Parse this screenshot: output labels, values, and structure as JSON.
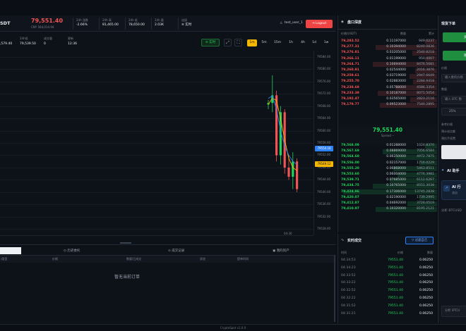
{
  "header": {
    "symbol_partial": "SDT",
    "price": "79,551.40",
    "price_sub": "CNY 564,014.94",
    "stats": [
      {
        "label": "24h 涨跌",
        "value": "-2.66%",
        "color": "#f25454"
      },
      {
        "label": "24h 高",
        "value": "81,465.00",
        "color": "#e6edf3"
      },
      {
        "label": "24h 低",
        "value": "78,650.00",
        "color": "#e6edf3"
      },
      {
        "label": "24h 量",
        "value": "2.03K",
        "color": "#e6edf3"
      },
      {
        "label": "连接",
        "value": "实时",
        "color": "#1fd35a"
      }
    ],
    "user": "test_user_1",
    "logout": "Logout"
  },
  "chart_info": {
    "cells": [
      {
        "label": "",
        "value": ",579.40"
      },
      {
        "label": "24h低",
        "value": "79,539.50"
      },
      {
        "label": "成交量",
        "value": "0"
      },
      {
        "label": "更新",
        "value": "12:36"
      }
    ],
    "live_label": "实时",
    "timeframes": [
      "1m",
      "5m",
      "15m",
      "1h",
      "4h",
      "1d",
      "1w"
    ],
    "active_tf": "1m",
    "time_tick": "04:30"
  },
  "chart_data": {
    "type": "candlestick",
    "yticks": [
      "79584.00",
      "79580.00",
      "79576.00",
      "79572.00",
      "79568.00",
      "79564.00",
      "79560.00",
      "79556.00",
      "79552.00",
      "79548.00",
      "79544.00",
      "79540.00",
      "79536.00",
      "79532.00",
      "79528.00"
    ],
    "ylim": [
      79526,
      79586
    ],
    "price_tags": [
      {
        "value": "79554.16",
        "color": "#2f81f7"
      },
      {
        "value": "79549.12",
        "color": "#f5b700"
      }
    ],
    "candles": [
      {
        "o": 79568.5,
        "h": 79570,
        "l": 79567,
        "c": 79569,
        "up": true
      },
      {
        "o": 79569,
        "h": 79578,
        "l": 79566,
        "c": 79571.5,
        "up": true
      },
      {
        "o": 79571.5,
        "h": 79573,
        "l": 79550,
        "c": 79552,
        "up": false
      },
      {
        "o": 79552,
        "h": 79568,
        "l": 79549,
        "c": 79566,
        "up": true
      },
      {
        "o": 79566,
        "h": 79567,
        "l": 79546,
        "c": 79548,
        "up": false
      },
      {
        "o": 79548,
        "h": 79552,
        "l": 79544,
        "c": 79545,
        "up": false
      },
      {
        "o": 79545,
        "h": 79553,
        "l": 79541,
        "c": 79550,
        "up": true
      },
      {
        "o": 79550,
        "h": 79551,
        "l": 79540,
        "c": 79541,
        "up": false
      }
    ],
    "ma_lines": [
      {
        "color": "#f5b700",
        "values": [
          79568.5,
          79570.6,
          79569.8,
          79564,
          79557,
          79551,
          79548,
          79547
        ]
      },
      {
        "color": "#2f81f7",
        "values": [
          79570.5,
          79571.3,
          79567,
          79560,
          79555,
          79552,
          79550,
          79549
        ]
      }
    ]
  },
  "orders": {
    "tabs": [
      "历史委托",
      "成交记录",
      "我的资产"
    ],
    "columns": [
      "/类型",
      "价格",
      "数量/已成交",
      "状态",
      "提单时间"
    ],
    "empty": "暂无当前订单"
  },
  "orderbook": {
    "title": "盘口深度",
    "columns": [
      "价格(USDT)",
      "数量",
      "累计"
    ],
    "asks": [
      [
        "79,283.52",
        "0.11197000",
        "949.0237",
        0.12
      ],
      [
        "79,277.31",
        "0.10394000",
        "8240.0836",
        0.62
      ],
      [
        "79,276.81",
        "0.03205000",
        "2540.8218",
        0.25
      ],
      [
        "79,266.11",
        "0.01199000",
        "950.4007",
        0.12
      ],
      [
        "79,264.71",
        "0.10694000",
        "8476.5681",
        0.65
      ],
      [
        "79,260.91",
        "0.02544000",
        "2016.3876",
        0.22
      ],
      [
        "79,259.61",
        "0.03719000",
        "2947.6649",
        0.28
      ],
      [
        "79,255.70",
        "0.02883000",
        "2284.9418",
        0.24
      ],
      [
        "79,238.69",
        "0.05788000",
        "4586.3354",
        0.42
      ],
      [
        "79,233.39",
        "0.10187000",
        "8071.5054",
        0.6
      ],
      [
        "79,192.47",
        "0.03565000",
        "2823.2116",
        0.27
      ],
      [
        "79,179.77",
        "0.09523000",
        "7540.2895",
        0.58
      ]
    ],
    "mid_price": "79,551.40",
    "spread_label": "Spread",
    "spread_value": "--",
    "bids": [
      [
        "79,568.09",
        "0.01288000",
        "1024.8370",
        0.12
      ],
      [
        "79,567.69",
        "0.08869000",
        "7056.6584",
        0.55
      ],
      [
        "79,564.60",
        "0.06250000",
        "4972.7875",
        0.42
      ],
      [
        "79,556.00",
        "0.02157000",
        "1716.0229",
        0.18
      ],
      [
        "79,555.20",
        "0.06868000",
        "5463.8511",
        0.44
      ],
      [
        "79,553.60",
        "0.06004000",
        "4776.3981",
        0.4
      ],
      [
        "79,539.71",
        "0.07685000",
        "6112.6267",
        0.48
      ],
      [
        "79,434.75",
        "0.10765000",
        "8551.3038",
        0.65
      ],
      [
        "79,424.96",
        "0.17306000",
        "13745.2838",
        0.95
      ],
      [
        "79,420.07",
        "0.02190000",
        "1739.2995",
        0.18
      ],
      [
        "79,412.87",
        "0.04692000",
        "3726.0519",
        0.3
      ],
      [
        "79,410.97",
        "0.10320000",
        "8195.2121",
        0.62
      ]
    ]
  },
  "trades": {
    "title": "实时成交",
    "filter_label": "过滤自己",
    "columns": [
      "时间",
      "价格",
      "数量"
    ],
    "rows": [
      [
        "04:34:53",
        "79551.40",
        "0.06250"
      ],
      [
        "04:34:23",
        "79551.40",
        "0.06250"
      ],
      [
        "04:33:52",
        "79551.40",
        "0.06250"
      ],
      [
        "04:33:22",
        "79551.40",
        "0.06250"
      ],
      [
        "04:32:52",
        "79551.40",
        "0.06250"
      ],
      [
        "04:32:22",
        "79551.40",
        "0.06250"
      ],
      [
        "04:31:52",
        "79551.40",
        "0.06250"
      ],
      [
        "04:31:21",
        "79551.40",
        "0.06250"
      ]
    ]
  },
  "trade_panel": {
    "title": "现货下单",
    "btn1": "买",
    "btn2": "限",
    "price_label": "价格",
    "price_placeholder": "输入委托价格",
    "qty_label": "数量",
    "qty_placeholder": "输入 BTC 数",
    "percent": "25%",
    "ref_price_label": "参考价格",
    "est_amount_label": "预计成交额",
    "est_fee_label": "预估手续费",
    "ai_title": "AI 助手",
    "ai_card_title": "AI 行",
    "ai_card_sub": "该自",
    "ai_analysis": "分析 BTCUSD",
    "ai_input": "分析 BTCU"
  },
  "footer": {
    "text": "CryptoSpot v1.0.0"
  },
  "colors": {
    "up": "#1fd35a",
    "down": "#f25454",
    "accent": "#f5b700",
    "danger": "#ef4444"
  }
}
